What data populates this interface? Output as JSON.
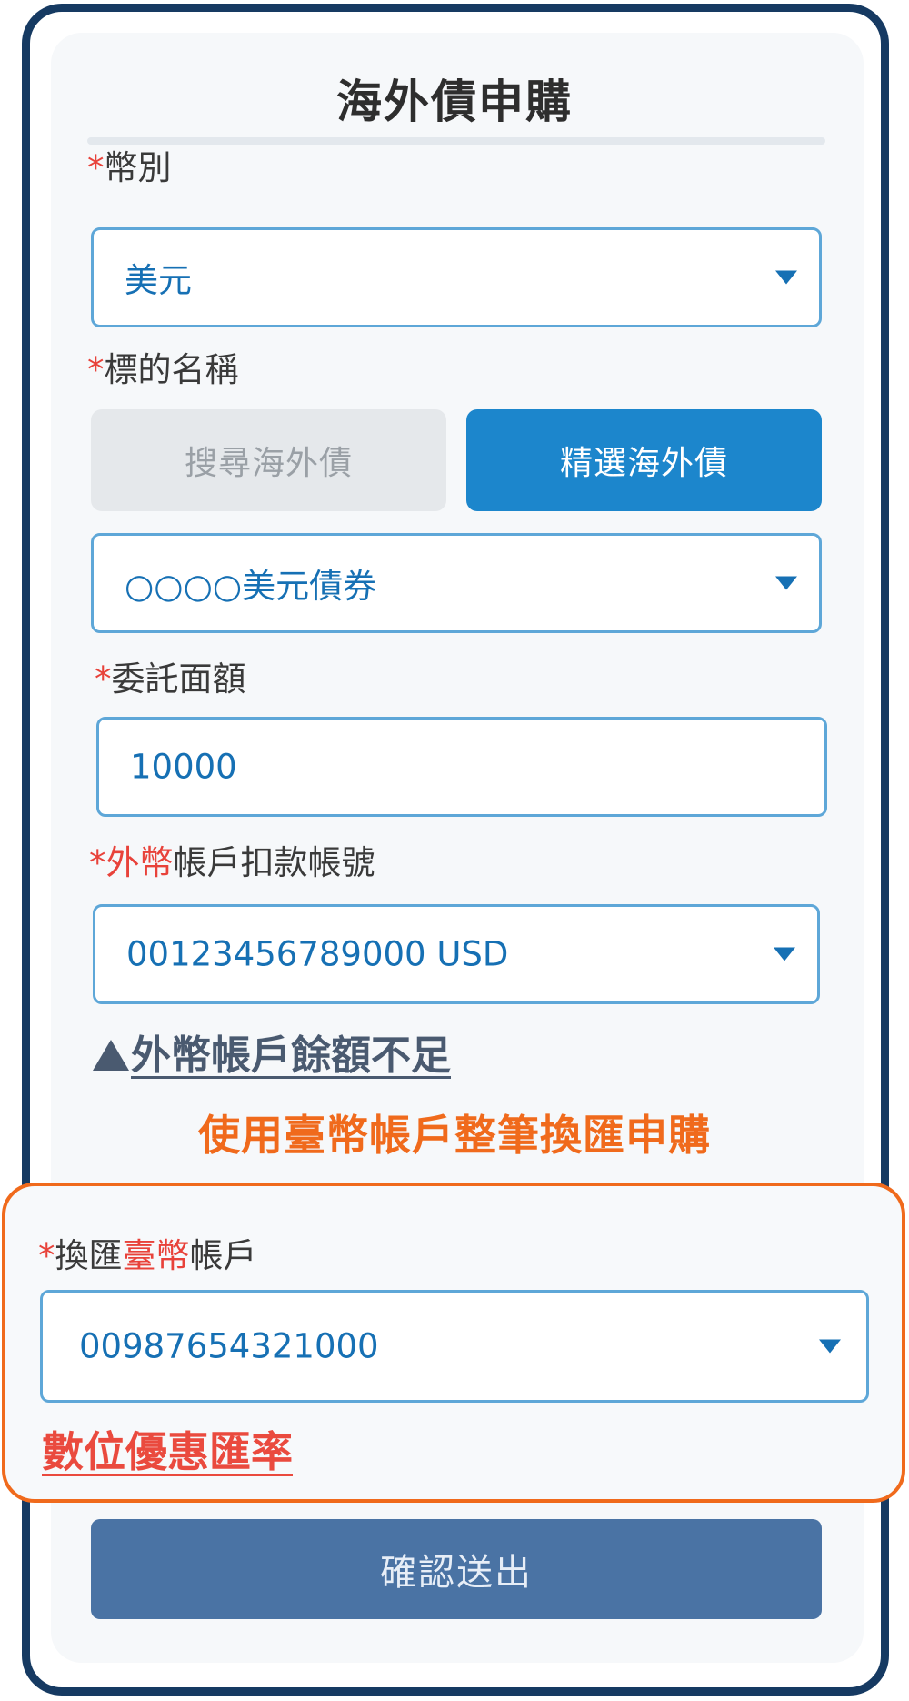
{
  "page": {
    "title": "海外債申購"
  },
  "currency": {
    "required_mark": "*",
    "label": "幣別",
    "value": "美元"
  },
  "target": {
    "required_mark": "*",
    "label": "標的名稱",
    "tabs": [
      {
        "label": "搜尋海外債",
        "selected": false
      },
      {
        "label": "精選海外債",
        "selected": true
      }
    ],
    "value": "○○○○美元債券"
  },
  "amount": {
    "required_mark": "*",
    "label": "委託面額",
    "value": "10000"
  },
  "debit_account": {
    "required_mark": "*",
    "label_highlight": "外幣",
    "label_rest": "帳戶扣款帳號",
    "value": "00123456789000 USD"
  },
  "warning": {
    "text": "外幣帳戶餘額不足"
  },
  "promo": {
    "text": "使用臺幣帳戶整筆換匯申購"
  },
  "exchange_account": {
    "required_mark": "*",
    "label_prefix": "換匯",
    "label_highlight": "臺幣",
    "label_suffix": "帳戶",
    "value": "00987654321000"
  },
  "rate_link": {
    "text": "數位優惠匯率"
  },
  "submit": {
    "label": "確認送出"
  },
  "colors": {
    "frame": "#163a62",
    "accent_blue": "#1c86cc",
    "value_blue": "#1670b4",
    "orange": "#f06a1c",
    "red": "#e8423a",
    "submit": "#4a73a4"
  }
}
